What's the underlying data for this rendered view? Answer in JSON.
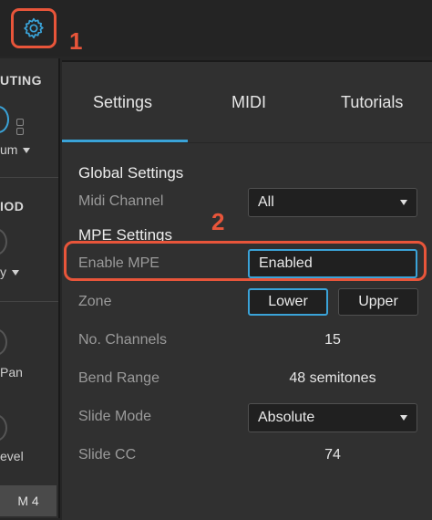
{
  "callouts": [
    "1",
    "2"
  ],
  "left_panel": {
    "routing_header": "UTING",
    "routing_value": "um",
    "mod_header": "IOD",
    "mod_value": "y",
    "pan_label": "Pan",
    "level_label": "evel",
    "tag": "M 4"
  },
  "tabs": [
    {
      "label": "Settings"
    },
    {
      "label": "MIDI"
    },
    {
      "label": "Tutorials"
    }
  ],
  "global_settings": {
    "title": "Global Settings",
    "midi_channel_label": "Midi Channel",
    "midi_channel_value": "All"
  },
  "mpe_settings": {
    "title": "MPE Settings",
    "enable_label": "Enable MPE",
    "enable_value": "Enabled",
    "zone_label": "Zone",
    "zone_options": [
      "Lower",
      "Upper"
    ],
    "zone_selected": "Lower",
    "channels_label": "No. Channels",
    "channels_value": "15",
    "bend_label": "Bend Range",
    "bend_value": "48 semitones",
    "slide_mode_label": "Slide Mode",
    "slide_mode_value": "Absolute",
    "slide_cc_label": "Slide CC",
    "slide_cc_value": "74"
  },
  "colors": {
    "accent": "#3aa3d8",
    "annotation": "#e8553a",
    "background": "#303030"
  }
}
